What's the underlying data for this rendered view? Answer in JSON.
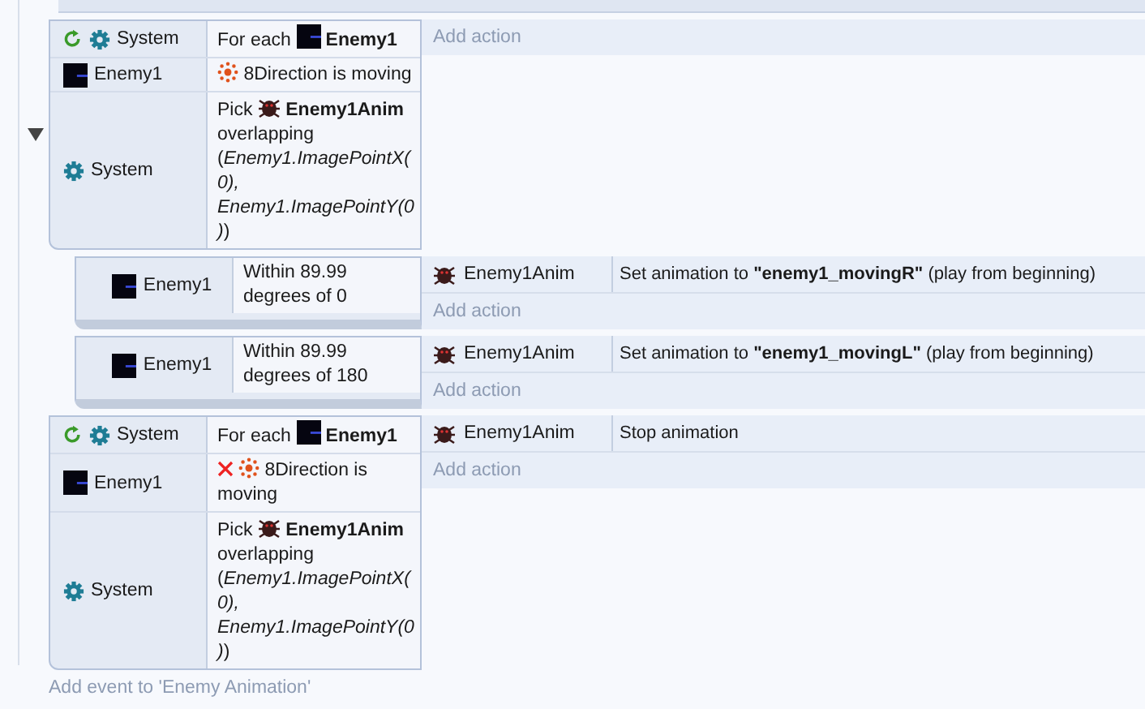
{
  "events": [
    {
      "expanded": true,
      "loop": true,
      "conditions": [
        {
          "object": {
            "name": "System",
            "kind": "system"
          },
          "inverted": false,
          "parts": [
            {
              "kind": "text",
              "text": "For each"
            },
            {
              "kind": "sprite",
              "text": "Enemy1"
            }
          ]
        },
        {
          "object": {
            "name": "Enemy1",
            "kind": "sprite"
          },
          "inverted": false,
          "parts": [
            {
              "kind": "behavior",
              "text": "8Direction is moving"
            }
          ]
        },
        {
          "object": {
            "name": "System",
            "kind": "system"
          },
          "inverted": false,
          "parts": [
            {
              "kind": "text",
              "text": "Pick"
            },
            {
              "kind": "animated",
              "text": "Enemy1Anim"
            },
            {
              "kind": "text",
              "text": "overlapping (*Enemy1.ImagePointX(0), Enemy1.ImagePointY(0)*)"
            }
          ]
        }
      ],
      "add_action": "Add action",
      "children": [
        {
          "loop": false,
          "conditions": [
            {
              "object": {
                "name": "Enemy1",
                "kind": "sprite"
              },
              "inverted": false,
              "parts": [
                {
                  "kind": "text",
                  "text": "Within 89.99 degrees of 0"
                }
              ]
            }
          ],
          "actions": [
            {
              "object": {
                "name": "Enemy1Anim",
                "kind": "animated"
              },
              "text": "Set animation to **\"enemy1_movingR\"** (play from beginning)"
            }
          ],
          "add_action": "Add action"
        },
        {
          "loop": false,
          "conditions": [
            {
              "object": {
                "name": "Enemy1",
                "kind": "sprite"
              },
              "inverted": false,
              "parts": [
                {
                  "kind": "text",
                  "text": "Within 89.99 degrees of 180"
                }
              ]
            }
          ],
          "actions": [
            {
              "object": {
                "name": "Enemy1Anim",
                "kind": "animated"
              },
              "text": "Set animation to **\"enemy1_movingL\"** (play from beginning)"
            }
          ],
          "add_action": "Add action"
        }
      ]
    },
    {
      "loop": true,
      "conditions": [
        {
          "object": {
            "name": "System",
            "kind": "system"
          },
          "inverted": false,
          "parts": [
            {
              "kind": "text",
              "text": "For each"
            },
            {
              "kind": "sprite",
              "text": "Enemy1"
            }
          ]
        },
        {
          "object": {
            "name": "Enemy1",
            "kind": "sprite"
          },
          "inverted": true,
          "parts": [
            {
              "kind": "behavior",
              "text": "8Direction is moving"
            }
          ]
        },
        {
          "object": {
            "name": "System",
            "kind": "system"
          },
          "inverted": false,
          "parts": [
            {
              "kind": "text",
              "text": "Pick"
            },
            {
              "kind": "animated",
              "text": "Enemy1Anim"
            },
            {
              "kind": "text",
              "text": "overlapping (*Enemy1.ImagePointX(0), Enemy1.ImagePointY(0)*)"
            }
          ]
        }
      ],
      "actions": [
        {
          "object": {
            "name": "Enemy1Anim",
            "kind": "animated"
          },
          "text": "Stop animation"
        }
      ],
      "add_action": "Add action"
    }
  ],
  "add_event": "Add event to 'Enemy Animation'"
}
